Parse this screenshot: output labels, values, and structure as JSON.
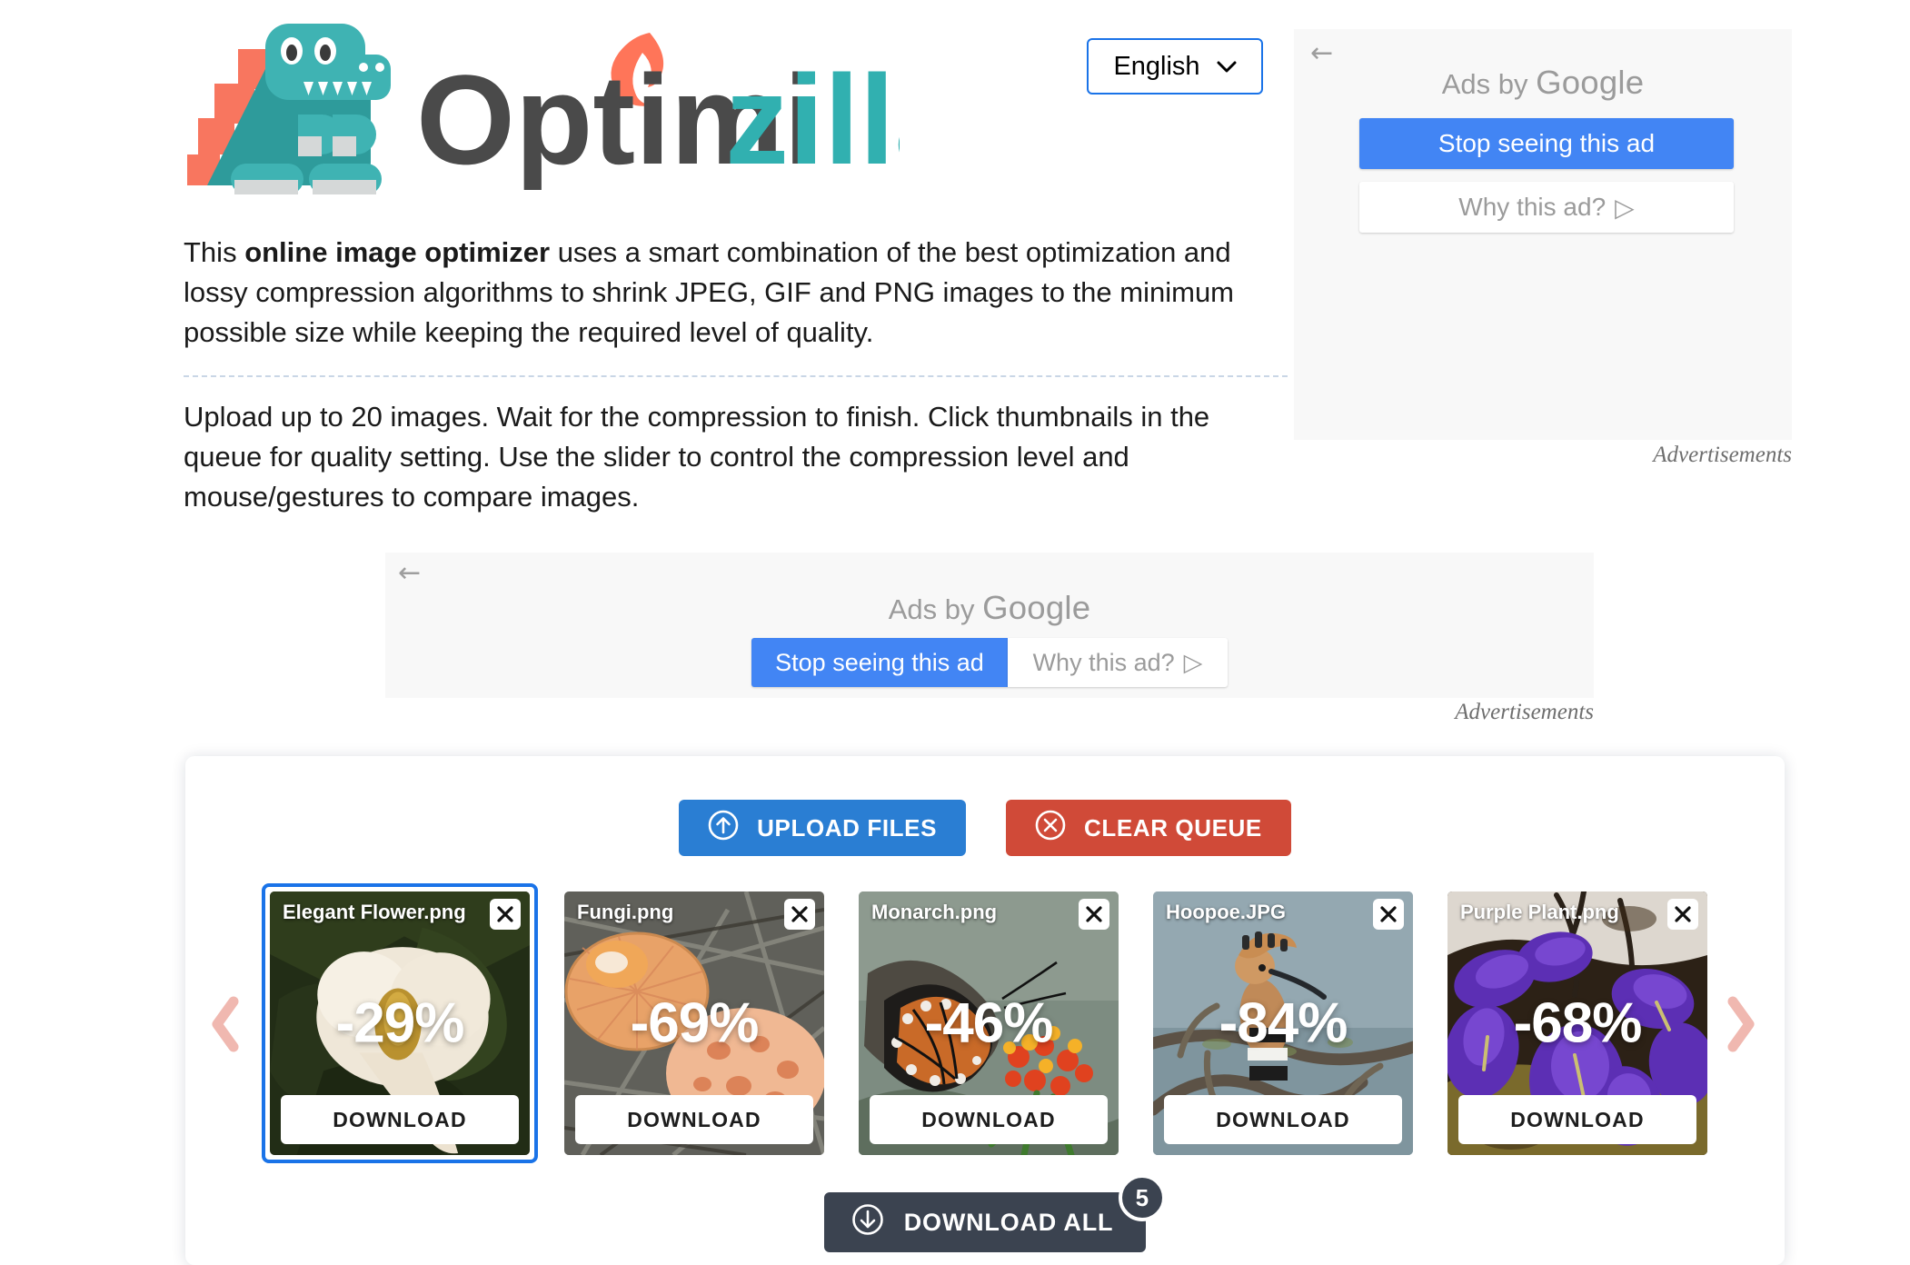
{
  "header": {
    "logo_text_dark": "Optimi",
    "logo_text_teal": "zilla",
    "logo_alt": "optimizilla-dinosaur-logo",
    "language": {
      "value": "English",
      "chevron": "⌄"
    }
  },
  "ads": {
    "back_arrow": "←",
    "ads_by_prefix": "Ads by ",
    "ads_by_brand": "Google",
    "stop_label": "Stop seeing this ad",
    "why_label": "Why this ad?",
    "why_icon": "▷",
    "advertisements_label": "Advertisements",
    "accent_blue": "#4285f4",
    "panel_bg": "#f8f8f8"
  },
  "intro": {
    "p1_before": "This ",
    "p1_bold": "online image optimizer",
    "p1_after": " uses a smart combination of the best optimization and lossy compression algorithms to shrink JPEG, GIF and PNG images to the minimum possible size while keeping the required level of quality.",
    "p2": "Upload up to 20 images. Wait for the compression to finish. Click thumbnails in the queue for quality setting. Use the slider to control the compression level and mouse/gestures to compare images."
  },
  "queue": {
    "upload_label": "UPLOAD FILES",
    "upload_icon": "upload-circle-icon",
    "upload_color": "#2a7ed3",
    "clear_label": "CLEAR QUEUE",
    "clear_icon": "x-circle-icon",
    "clear_color": "#d04a38",
    "prev_arrow_icon": "chevron-left-icon",
    "next_arrow_icon": "chevron-right-icon",
    "arrow_color": "#f0b8b0",
    "download_label": "DOWNLOAD",
    "close_icon": "close-x-icon",
    "download_all_label": "DOWNLOAD ALL",
    "download_all_icon": "download-circle-icon",
    "download_all_count": "5",
    "items": [
      {
        "name": "Elegant Flower.png",
        "percent": "-29%",
        "selected": true,
        "thumb": "flower"
      },
      {
        "name": "Fungi.png",
        "percent": "-69%",
        "selected": false,
        "thumb": "fungi"
      },
      {
        "name": "Monarch.png",
        "percent": "-46%",
        "selected": false,
        "thumb": "monarch"
      },
      {
        "name": "Hoopoe.JPG",
        "percent": "-84%",
        "selected": false,
        "thumb": "hoopoe"
      },
      {
        "name": "Purple Plant.png",
        "percent": "-68%",
        "selected": false,
        "thumb": "purple"
      }
    ]
  }
}
